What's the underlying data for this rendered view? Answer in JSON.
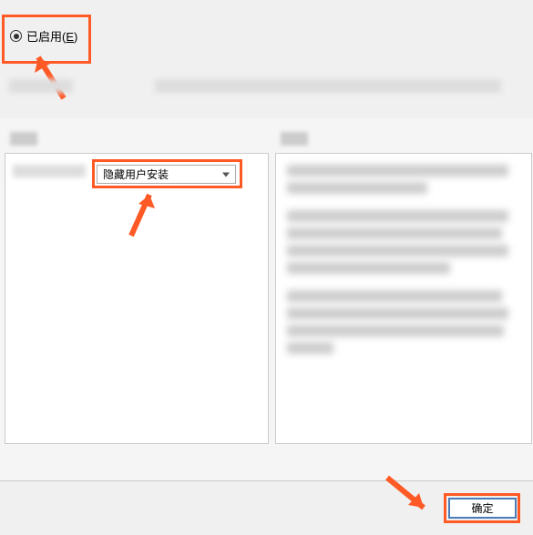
{
  "radio": {
    "enabled_label": "已启用",
    "shortcut": "E"
  },
  "dropdown": {
    "selected_value": "隐藏用户安装"
  },
  "buttons": {
    "ok_label": "确定"
  },
  "colors": {
    "highlight": "#ff5a26",
    "button_border": "#4a7ebb"
  }
}
